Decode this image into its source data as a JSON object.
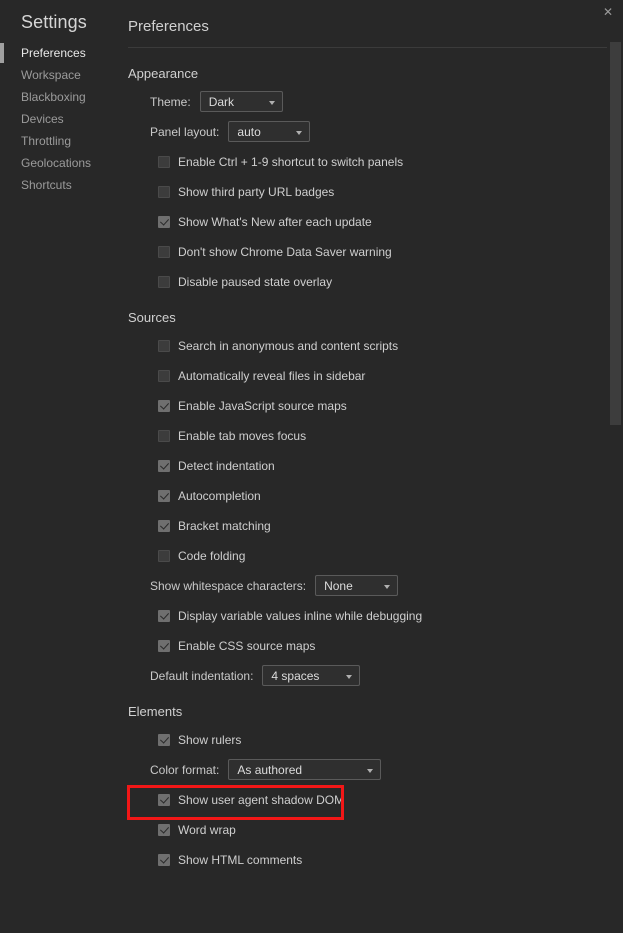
{
  "window": {
    "close_label": "✕"
  },
  "sidebar": {
    "title": "Settings",
    "items": [
      {
        "label": "Preferences",
        "selected": true
      },
      {
        "label": "Workspace",
        "selected": false
      },
      {
        "label": "Blackboxing",
        "selected": false
      },
      {
        "label": "Devices",
        "selected": false
      },
      {
        "label": "Throttling",
        "selected": false
      },
      {
        "label": "Geolocations",
        "selected": false
      },
      {
        "label": "Shortcuts",
        "selected": false
      }
    ]
  },
  "main": {
    "title": "Preferences",
    "sections": [
      {
        "title": "Appearance",
        "rows": [
          {
            "kind": "select",
            "label": "Theme:",
            "value": "Dark",
            "width": "w-theme"
          },
          {
            "kind": "select",
            "label": "Panel layout:",
            "value": "auto",
            "width": "w-panel"
          },
          {
            "kind": "checkbox",
            "label": "Enable Ctrl + 1-9 shortcut to switch panels",
            "checked": false
          },
          {
            "kind": "checkbox",
            "label": "Show third party URL badges",
            "checked": false
          },
          {
            "kind": "checkbox",
            "label": "Show What's New after each update",
            "checked": true
          },
          {
            "kind": "checkbox",
            "label": "Don't show Chrome Data Saver warning",
            "checked": false
          },
          {
            "kind": "checkbox",
            "label": "Disable paused state overlay",
            "checked": false
          }
        ]
      },
      {
        "title": "Sources",
        "rows": [
          {
            "kind": "checkbox",
            "label": "Search in anonymous and content scripts",
            "checked": false
          },
          {
            "kind": "checkbox",
            "label": "Automatically reveal files in sidebar",
            "checked": false
          },
          {
            "kind": "checkbox",
            "label": "Enable JavaScript source maps",
            "checked": true
          },
          {
            "kind": "checkbox",
            "label": "Enable tab moves focus",
            "checked": false
          },
          {
            "kind": "checkbox",
            "label": "Detect indentation",
            "checked": true
          },
          {
            "kind": "checkbox",
            "label": "Autocompletion",
            "checked": true
          },
          {
            "kind": "checkbox",
            "label": "Bracket matching",
            "checked": true
          },
          {
            "kind": "checkbox",
            "label": "Code folding",
            "checked": false
          },
          {
            "kind": "select",
            "label": "Show whitespace characters:",
            "value": "None",
            "width": "w-ws"
          },
          {
            "kind": "checkbox",
            "label": "Display variable values inline while debugging",
            "checked": true
          },
          {
            "kind": "checkbox",
            "label": "Enable CSS source maps",
            "checked": true
          },
          {
            "kind": "select",
            "label": "Default indentation:",
            "value": "4 spaces",
            "width": "w-indent"
          }
        ]
      },
      {
        "title": "Elements",
        "rows": [
          {
            "kind": "checkbox",
            "label": "Show rulers",
            "checked": true
          },
          {
            "kind": "select",
            "label": "Color format:",
            "value": "As authored",
            "width": "w-color"
          },
          {
            "kind": "checkbox",
            "label": "Show user agent shadow DOM",
            "checked": true,
            "highlight": true
          },
          {
            "kind": "checkbox",
            "label": "Word wrap",
            "checked": true
          },
          {
            "kind": "checkbox",
            "label": "Show HTML comments",
            "checked": true
          }
        ]
      }
    ]
  },
  "colors": {
    "background": "#282828",
    "text": "#cfcfcf",
    "highlight": "#f21717",
    "selected_bar": "#a0a0a0"
  }
}
